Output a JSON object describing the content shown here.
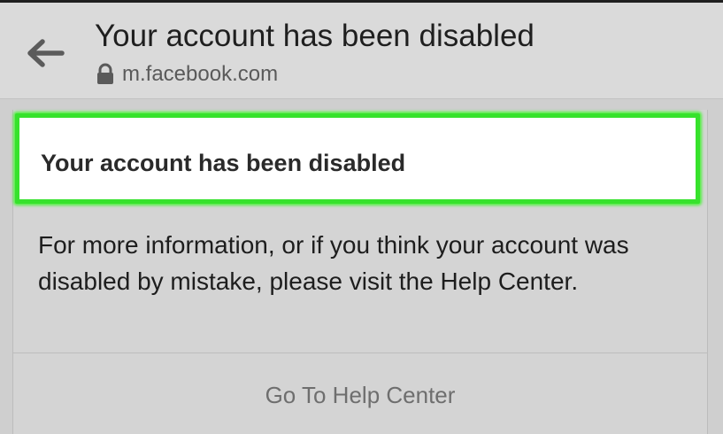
{
  "browser": {
    "page_title": "Your account has been disabled",
    "url": "m.facebook.com",
    "icons": {
      "back": "back-arrow-icon",
      "lock": "lock-icon"
    }
  },
  "dialog": {
    "title": "Your account has been disabled",
    "message": "For more information, or if you think your account was disabled by mistake, please visit the Help Center.",
    "help_button": "Go To Help Center",
    "highlight_color": "#36e22c"
  }
}
